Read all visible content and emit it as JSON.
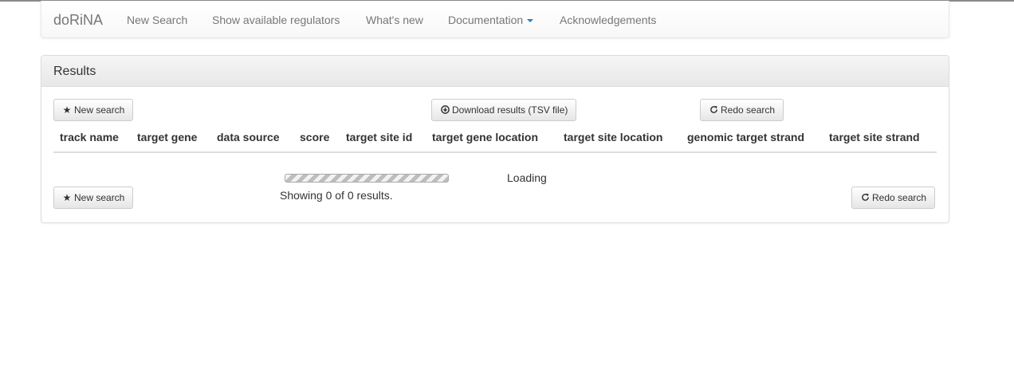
{
  "navbar": {
    "brand": "doRiNA",
    "items": [
      {
        "label": "New Search"
      },
      {
        "label": "Show available regulators"
      },
      {
        "label": "What's new"
      },
      {
        "label": "Documentation"
      },
      {
        "label": "Acknowledgements"
      }
    ]
  },
  "results": {
    "title": "Results",
    "top_buttons": {
      "new_search": "New search",
      "download": "Download results (TSV file)",
      "redo": "Redo search"
    },
    "columns": [
      "track name",
      "target gene",
      "data source",
      "score",
      "target site id",
      "target gene location",
      "target site location",
      "genomic target strand",
      "target site strand"
    ],
    "loading_text": "Loading",
    "progress": 0,
    "info_text": "Showing 0 of 0 results.",
    "bottom_buttons": {
      "new_search": "New search",
      "redo": "Redo search"
    }
  },
  "icons": {
    "star": "star-icon",
    "download": "circle-arrow-down-icon",
    "refresh": "refresh-icon"
  },
  "colors": {
    "nav_text": "#777777",
    "caret": "#337ab7",
    "text": "#333333",
    "panel_border": "#dddddd"
  }
}
